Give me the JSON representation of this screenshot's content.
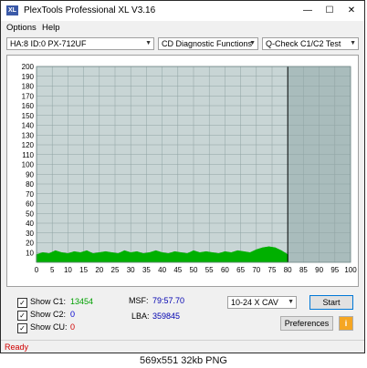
{
  "window": {
    "title": "PlexTools Professional XL V3.16",
    "icon_label": "XL"
  },
  "menu": [
    "Options",
    "Help"
  ],
  "toolbar": {
    "drive": "HA:8 ID:0  PX-712UF",
    "function": "CD Diagnostic Functions",
    "test": "Q-Check C1/C2 Test"
  },
  "chart_data": {
    "type": "area",
    "x_ticks": [
      "0",
      "5",
      "10",
      "15",
      "20",
      "25",
      "30",
      "35",
      "40",
      "45",
      "50",
      "55",
      "60",
      "65",
      "70",
      "75",
      "80",
      "85",
      "90",
      "95",
      "100"
    ],
    "y_ticks": [
      "10",
      "20",
      "30",
      "40",
      "50",
      "60",
      "70",
      "80",
      "90",
      "100",
      "110",
      "120",
      "130",
      "140",
      "150",
      "160",
      "170",
      "180",
      "190",
      "200"
    ],
    "xlim": [
      0,
      100
    ],
    "ylim": [
      0,
      200
    ],
    "grid": true,
    "measured_until": 80,
    "series": [
      {
        "color": "#00b000",
        "x": [
          0,
          2,
          4,
          6,
          8,
          10,
          12,
          14,
          16,
          18,
          20,
          22,
          24,
          26,
          28,
          30,
          32,
          34,
          36,
          38,
          40,
          42,
          44,
          46,
          48,
          50,
          52,
          54,
          56,
          58,
          60,
          62,
          64,
          66,
          68,
          70,
          72,
          74,
          76,
          78,
          80
        ],
        "values": [
          8,
          10,
          9,
          12,
          10,
          9,
          11,
          10,
          12,
          9,
          10,
          11,
          10,
          9,
          12,
          10,
          11,
          9,
          10,
          12,
          10,
          9,
          11,
          10,
          9,
          12,
          10,
          11,
          10,
          9,
          11,
          10,
          12,
          11,
          10,
          13,
          15,
          16,
          15,
          12,
          8
        ]
      }
    ],
    "colors": {
      "plot_bg": "#a9bcbc",
      "measured_bg": "#c8d5d5",
      "grid": "#8fa3a3",
      "marker": "#000000"
    }
  },
  "checks": [
    {
      "label": "Show C1:",
      "value": "13454",
      "color": "#00a000"
    },
    {
      "label": "Show C2:",
      "value": "0",
      "color": "#0000d0"
    },
    {
      "label": "Show CU:",
      "value": "0",
      "color": "#d00000"
    }
  ],
  "info": {
    "msf_label": "MSF:",
    "msf_value": "79:57.70",
    "lba_label": "LBA:",
    "lba_value": "359845"
  },
  "speed": "10-24 X CAV",
  "buttons": {
    "start": "Start",
    "preferences": "Preferences",
    "info": "i"
  },
  "status": "Ready",
  "caption": "569x551  32kb  PNG"
}
